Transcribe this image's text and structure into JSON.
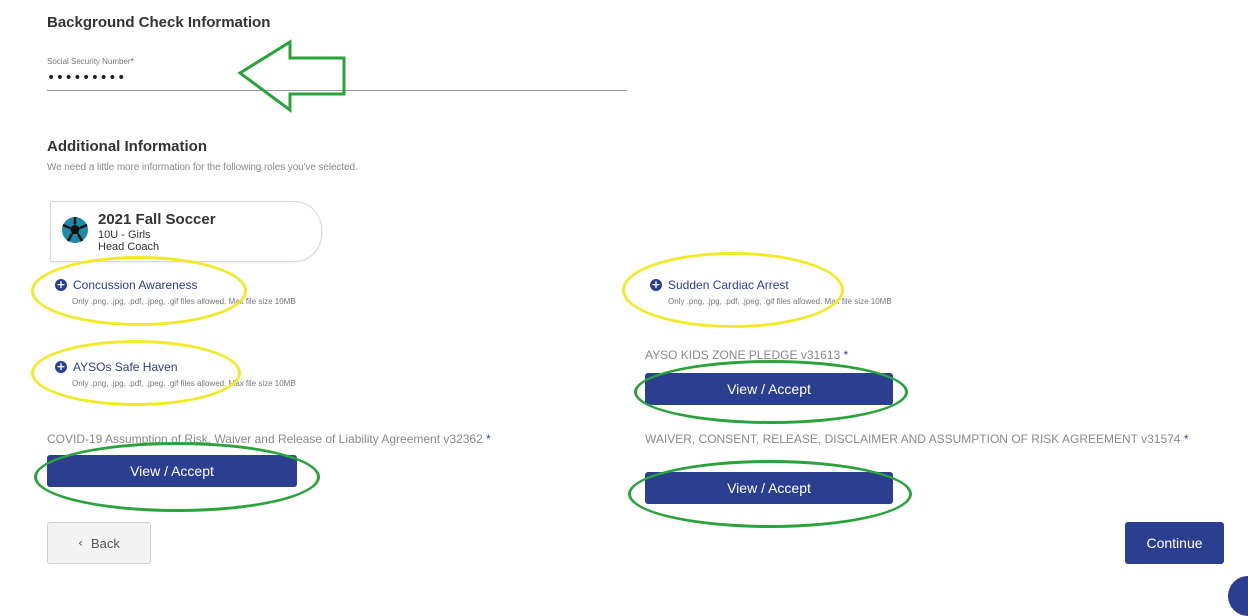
{
  "background_check": {
    "title": "Background Check Information",
    "ssn_label": "Social Security Number",
    "required_mark": "*",
    "ssn_value": "•••••••••"
  },
  "additional": {
    "title": "Additional Information",
    "subtitle": "We need a little more information for the following roles you've selected."
  },
  "program": {
    "name": "2021 Fall Soccer",
    "division": "10U - Girls",
    "role": "Head Coach",
    "icon": "soccer-ball-icon"
  },
  "uploads": [
    {
      "label": "Concussion Awareness",
      "note": "Only .png, .jpg, .pdf, .jpeg, .gif files allowed.  Max file size 10MB"
    },
    {
      "label": "Sudden Cardiac Arrest",
      "note": "Only .png, .jpg, .pdf, .jpeg, .gif files allowed.  Max file size 10MB"
    },
    {
      "label": "AYSOs Safe Haven",
      "note": "Only .png, .jpg, .pdf, .jpeg, .gif files allowed.  Max file size 10MB"
    }
  ],
  "waivers": [
    {
      "label": "AYSO KIDS ZONE PLEDGE v31613",
      "button": "View / Accept"
    },
    {
      "label": "COVID-19 Assumption of Risk, Waiver and Release of Liability Agreement v32362",
      "button": "View / Accept"
    },
    {
      "label": "WAIVER, CONSENT, RELEASE, DISCLAIMER AND ASSUMPTION OF RISK AGREEMENT v31574",
      "button": "View / Accept"
    }
  ],
  "nav": {
    "back_label": "Back",
    "continue_label": "Continue"
  },
  "colors": {
    "primary": "#2c3e8f",
    "annotation_yellow": "#f2ea27",
    "annotation_green": "#2aa33c"
  }
}
